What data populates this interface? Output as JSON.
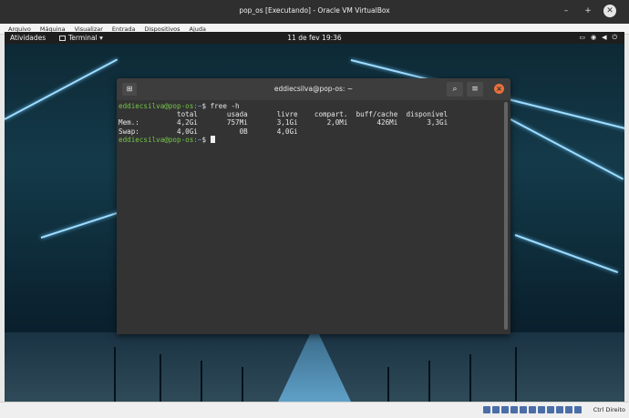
{
  "host_window": {
    "title": "pop_os [Executando] - Oracle VM VirtualBox",
    "controls": [
      "–",
      "+",
      "✕"
    ],
    "menu": [
      "Arquivo",
      "Máquina",
      "Visualizar",
      "Entrada",
      "Dispositivos",
      "Ajuda"
    ],
    "host_key": "Ctrl Direito"
  },
  "gnome_bar": {
    "activities": "Atividades",
    "app_menu": "Terminal ▾",
    "clock": "11 de fev  19:36",
    "tray_icons": [
      "screen-icon",
      "accessibility-icon",
      "volume-icon",
      "power-icon"
    ]
  },
  "terminal": {
    "title": "eddiecsilva@pop-os: ~",
    "prompt_user": "eddiecsilva@pop-os",
    "prompt_path": ":~",
    "prompt_sym": "$ ",
    "command": "free -h",
    "lines": [
      "              total       usada       livre    compart.  buff/cache  disponível",
      "Mem.:         4,2Gi       757Mi       3,1Gi       2,0Mi       426Mi       3,3Gi",
      "Swap:         4,0Gi          0B       4,0Gi"
    ]
  },
  "colors": {
    "prompt_user": "#74c64a",
    "prompt_path": "#6fa8dc",
    "close_button": "#e8713b"
  }
}
